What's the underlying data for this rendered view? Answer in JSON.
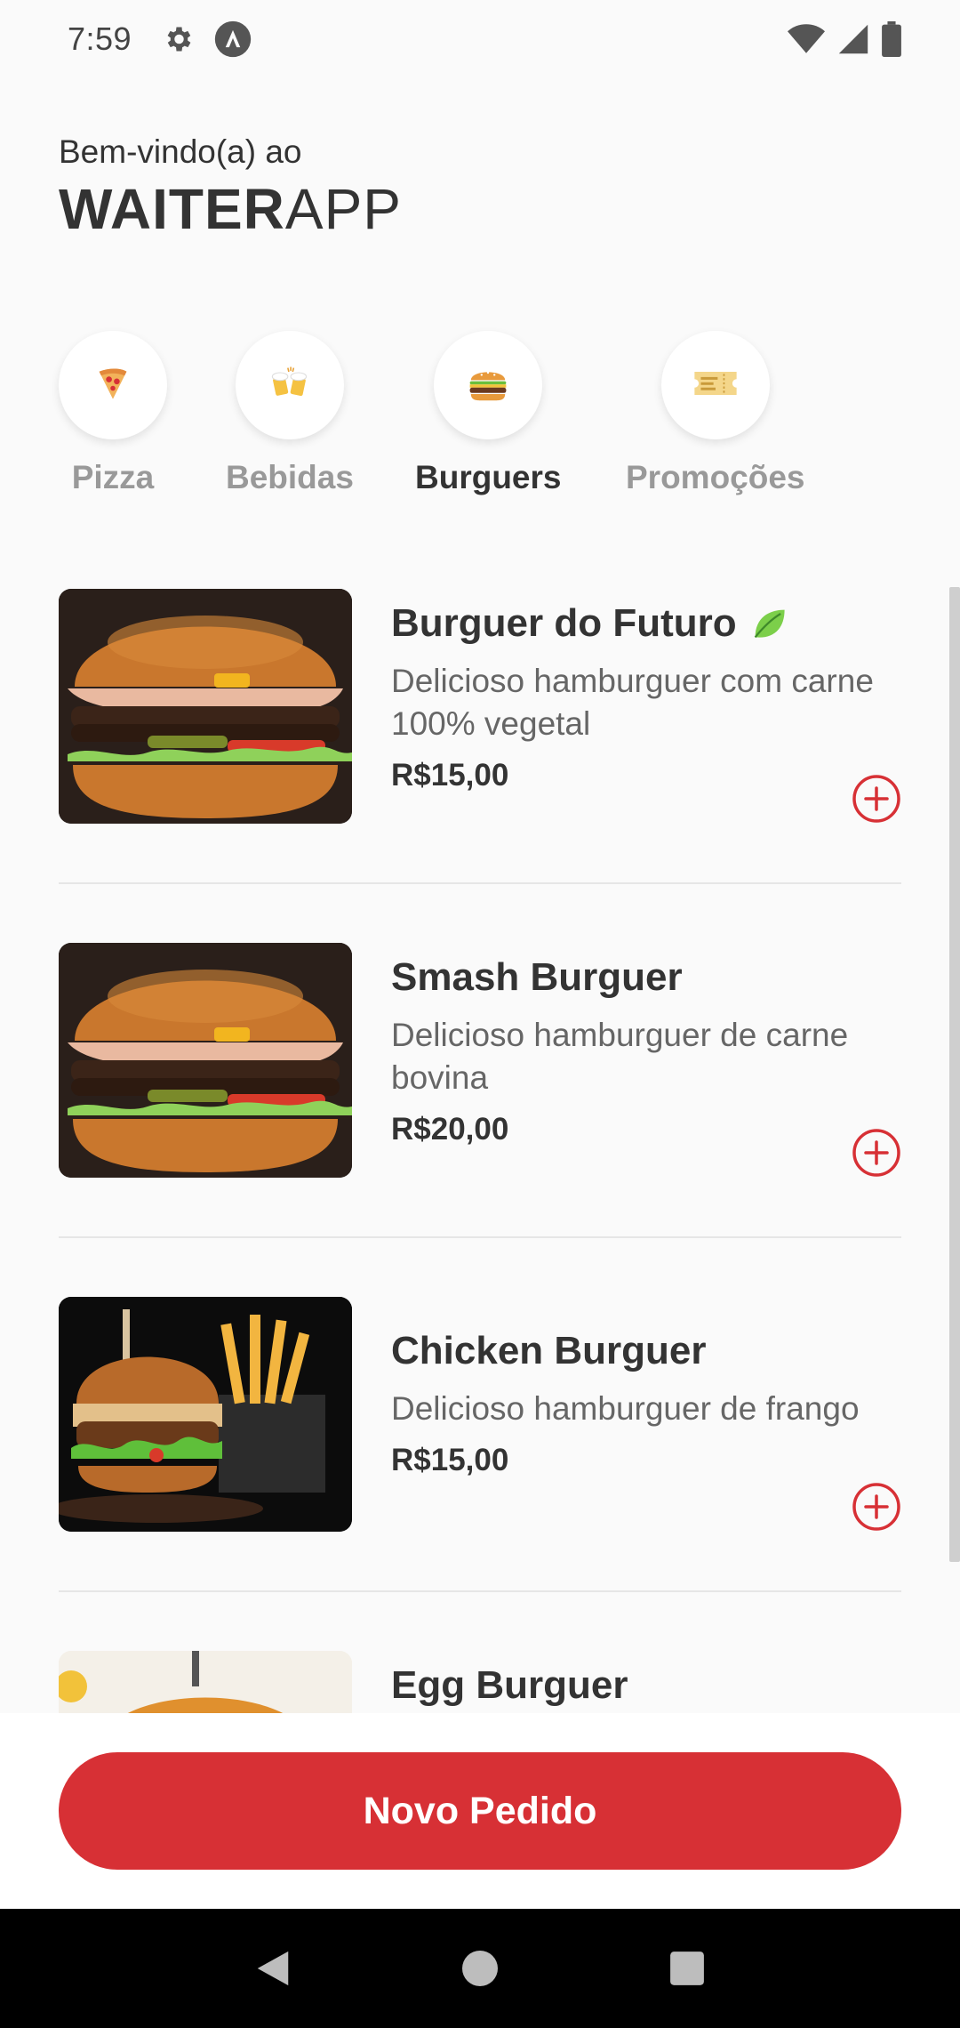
{
  "status_bar": {
    "time": "7:59",
    "left_icons": [
      "gear-icon",
      "android-icon"
    ],
    "right_icons": [
      "wifi-icon",
      "signal-icon",
      "battery-icon"
    ]
  },
  "header": {
    "welcome": "Bem-vindo(a) ao",
    "brand_bold": "WAITER",
    "brand_light": "APP"
  },
  "categories": [
    {
      "emoji": "🍕",
      "label": "Pizza",
      "active": false
    },
    {
      "emoji": "🍻",
      "label": "Bebidas",
      "active": false
    },
    {
      "emoji": "🍔",
      "label": "Burguers",
      "active": true
    },
    {
      "emoji": "🎫",
      "label": "Promoções",
      "active": false
    }
  ],
  "products": [
    {
      "name": "Burguer do Futuro",
      "badge": "🍃",
      "description": "Delicioso hamburguer com carne 100% vegetal",
      "price": "R$15,00"
    },
    {
      "name": "Smash Burguer",
      "badge": "",
      "description": "Delicioso hamburguer de carne bovina",
      "price": "R$20,00"
    },
    {
      "name": "Chicken Burguer",
      "badge": "",
      "description": "Delicioso hamburguer de frango",
      "price": "R$15,00"
    },
    {
      "name": "Egg Burguer",
      "badge": "",
      "description": "",
      "price": ""
    }
  ],
  "footer": {
    "new_order_label": "Novo Pedido"
  },
  "colors": {
    "accent": "#d73035",
    "text": "#333333",
    "muted": "#999999",
    "background": "#fafafa"
  },
  "nav_bar": [
    "back-icon",
    "home-icon",
    "recents-icon"
  ]
}
